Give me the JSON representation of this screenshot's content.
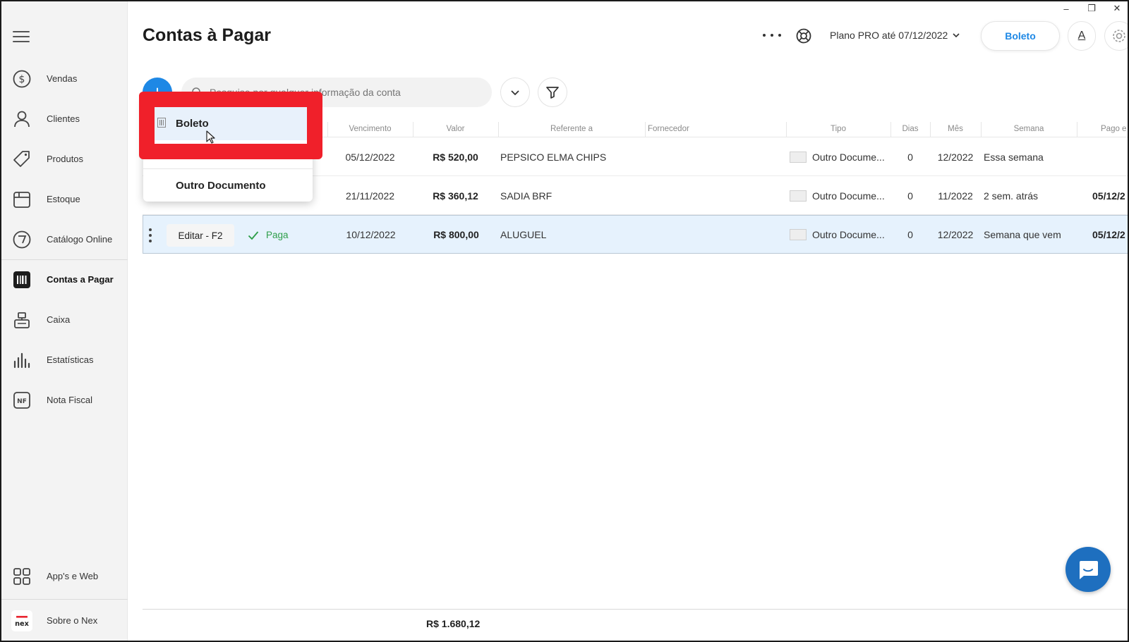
{
  "window": {
    "controls": [
      "–",
      "❐",
      "✕"
    ]
  },
  "sidebar": {
    "items": [
      {
        "label": "Vendas",
        "icon": "dollar-circle-icon"
      },
      {
        "label": "Clientes",
        "icon": "person-icon"
      },
      {
        "label": "Produtos",
        "icon": "tag-icon"
      },
      {
        "label": "Estoque",
        "icon": "box-icon"
      },
      {
        "label": "Catálogo Online",
        "icon": "catalog-icon"
      },
      {
        "label": "Contas a Pagar",
        "icon": "barcode-icon",
        "active": true
      },
      {
        "label": "Caixa",
        "icon": "cash-register-icon"
      },
      {
        "label": "Estatísticas",
        "icon": "bar-chart-icon"
      },
      {
        "label": "Nota Fiscal",
        "icon": "nf-icon",
        "badge": "NF"
      }
    ],
    "bottom": [
      {
        "label": "App's e Web",
        "icon": "apps-grid-icon"
      },
      {
        "label": "Sobre o Nex",
        "icon": "nex-logo-icon",
        "logo_text": "nex"
      }
    ]
  },
  "header": {
    "title": "Contas à Pagar",
    "plan": "Plano PRO até 07/12/2022",
    "boleto_button": "Boleto",
    "font_button": "A"
  },
  "toolbar": {
    "add": "+",
    "search_placeholder": "Pesquise por qualquer informação da conta"
  },
  "dropdown": {
    "items": [
      {
        "label": "Boleto",
        "highlighted": true
      },
      {
        "label": "Outro Documento",
        "highlighted": false
      }
    ]
  },
  "table": {
    "columns": [
      "Vencimento",
      "Valor",
      "Referente a",
      "Fornecedor",
      "Tipo",
      "Dias",
      "Mês",
      "Semana",
      "Pago e"
    ],
    "rows": [
      {
        "vencimento": "05/12/2022",
        "valor": "R$ 520,00",
        "referente": "PEPSICO ELMA CHIPS",
        "fornecedor": "",
        "tipo": "Outro Docume...",
        "dias": "0",
        "mes": "12/2022",
        "semana": "Essa semana",
        "pago": ""
      },
      {
        "vencimento": "21/11/2022",
        "valor": "R$ 360,12",
        "referente": "SADIA BRF",
        "fornecedor": "",
        "tipo": "Outro Docume...",
        "dias": "0",
        "mes": "11/2022",
        "semana": "2 sem. atrás",
        "pago": "05/12/2"
      },
      {
        "vencimento": "10/12/2022",
        "valor": "R$ 800,00",
        "referente": "ALUGUEL",
        "fornecedor": "",
        "tipo": "Outro Docume...",
        "dias": "0",
        "mes": "12/2022",
        "semana": "Semana que vem",
        "pago": "05/12/2",
        "edit_label": "Editar - F2",
        "status": "Paga",
        "selected": true
      }
    ]
  },
  "footer": {
    "total": "R$ 1.680,12"
  },
  "colors": {
    "accent": "#1e88e5",
    "highlight_box": "#f0202a",
    "paid": "#2e9e4a"
  }
}
